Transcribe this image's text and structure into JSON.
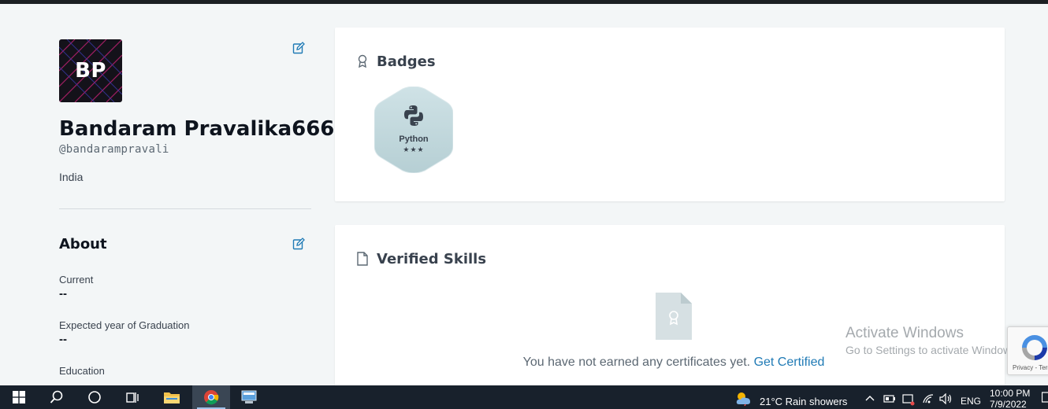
{
  "profile": {
    "initials": "BP",
    "name": "Bandaram Pravalika666",
    "handle": "@bandarampravali",
    "country": "India"
  },
  "about": {
    "title": "About",
    "fields": [
      {
        "label": "Current",
        "value": "--"
      },
      {
        "label": "Expected year of Graduation",
        "value": "--"
      },
      {
        "label": "Education",
        "value": ""
      }
    ]
  },
  "badges": {
    "title": "Badges",
    "items": [
      {
        "name": "Python",
        "stars": "★★★",
        "icon": "python-icon"
      }
    ]
  },
  "verified_skills": {
    "title": "Verified Skills",
    "empty_message": "You have not earned any certificates yet.",
    "cta": "Get Certified"
  },
  "watermark": {
    "title": "Activate Windows",
    "subtitle": "Go to Settings to activate Windows."
  },
  "recaptcha": {
    "text": "Privacy - Terms"
  },
  "taskbar": {
    "weather": "21°C  Rain showers",
    "language": "ENG",
    "time": "10:00 PM",
    "date": "7/9/2022"
  },
  "colors": {
    "link": "#1f7ab5",
    "background": "#f3f6f7",
    "taskbar": "#18212c"
  }
}
